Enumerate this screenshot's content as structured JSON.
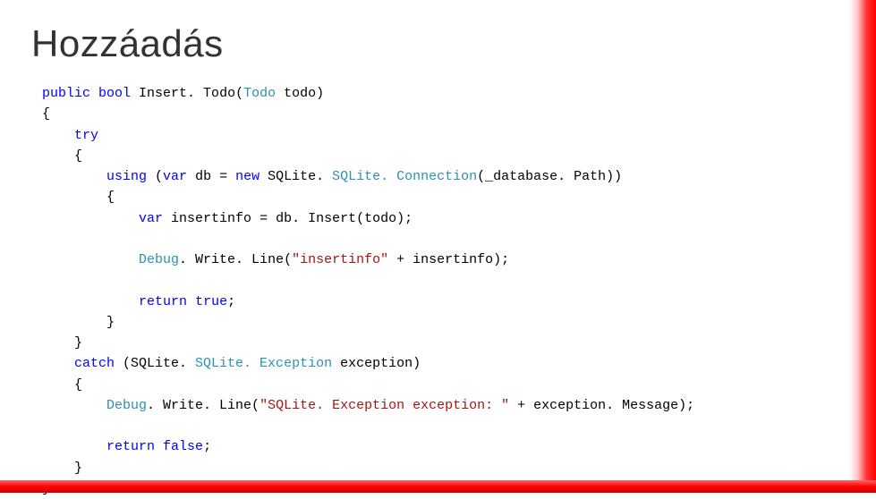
{
  "title": "Hozzáadás",
  "code": {
    "l1a": "public",
    "l1b": "bool",
    "l1c": " Insert. Todo(",
    "l1d": "Todo",
    "l1e": " todo)",
    "l2": "{",
    "l3a": "    ",
    "l3b": "try",
    "l4": "    {",
    "l5a": "        ",
    "l5b": "using",
    "l5c": " (",
    "l5d": "var",
    "l5e": " db = ",
    "l5f": "new",
    "l5g": " SQLite. ",
    "l5h": "SQLite. Connection",
    "l5i": "(_database. Path))",
    "l6": "        {",
    "l7a": "            ",
    "l7b": "var",
    "l7c": " insertinfo = db. Insert(todo);",
    "l8": "",
    "l9a": "            ",
    "l9b": "Debug",
    "l9c": ". Write. Line(",
    "l9d": "\"insertinfo\"",
    "l9e": " + insertinfo);",
    "l10": "",
    "l11a": "            ",
    "l11b": "return",
    "l11c": " ",
    "l11d": "true",
    "l11e": ";",
    "l12": "        }",
    "l13": "    }",
    "l14a": "    ",
    "l14b": "catch",
    "l14c": " (SQLite. ",
    "l14d": "SQLite. Exception",
    "l14e": " exception)",
    "l15": "    {",
    "l16a": "        ",
    "l16b": "Debug",
    "l16c": ". Write. Line(",
    "l16d": "\"SQLite. Exception exception: \"",
    "l16e": " + exception. Message);",
    "l17": "",
    "l18a": "        ",
    "l18b": "return",
    "l18c": " ",
    "l18d": "false",
    "l18e": ";",
    "l19": "    }",
    "l20": "}"
  }
}
